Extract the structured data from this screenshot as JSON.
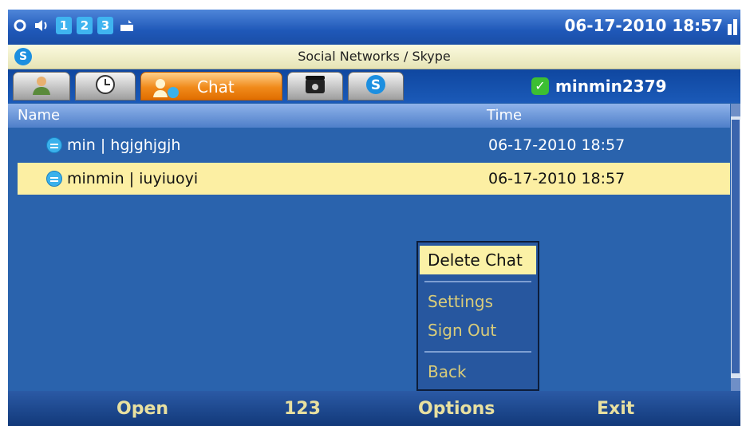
{
  "status_bar": {
    "icons": [
      "sync-icon",
      "speaker-icon",
      "tray-icon"
    ],
    "numbers": [
      "1",
      "2",
      "3"
    ],
    "datetime": "06-17-2010 18:57"
  },
  "title_bar": {
    "title": "Social Networks / Skype"
  },
  "tabs": [
    {
      "name": "contacts",
      "icon": "contacts-icon"
    },
    {
      "name": "history",
      "icon": "clock-icon"
    },
    {
      "name": "chat",
      "label": "Chat",
      "icon": "chat-icon",
      "active": true
    },
    {
      "name": "phone",
      "icon": "phone-icon"
    },
    {
      "name": "skype",
      "icon": "skype-icon"
    }
  ],
  "user": {
    "name": "minmin2379",
    "status": "online"
  },
  "list": {
    "headers": {
      "name": "Name",
      "time": "Time"
    },
    "rows": [
      {
        "name": "min | hgjghjgjh",
        "time": "06-17-2010 18:57",
        "selected": false
      },
      {
        "name": "minmin | iuyiuoyi",
        "time": "06-17-2010 18:57",
        "selected": true
      }
    ]
  },
  "menu": {
    "items": [
      "Delete Chat",
      "Settings",
      "Sign Out",
      "Back"
    ],
    "highlighted": "Delete Chat"
  },
  "softkeys": {
    "left": "Open",
    "middle": "123",
    "right_center": "Options",
    "right": "Exit"
  },
  "colors": {
    "selection": "#fcefa3",
    "active_tab": "#f08a1a",
    "background": "#2a63ad"
  }
}
